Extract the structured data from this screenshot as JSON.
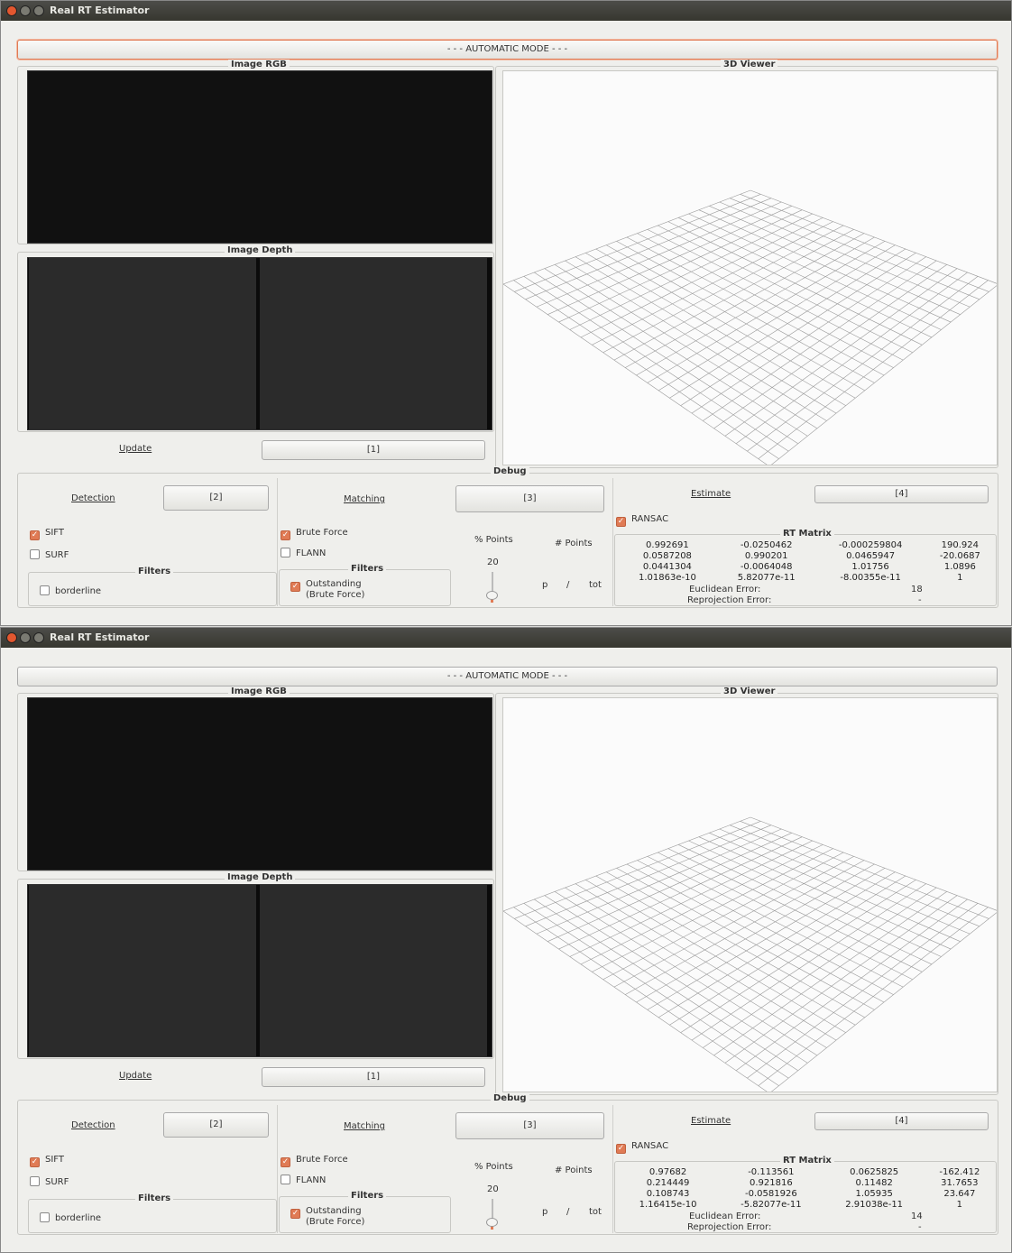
{
  "windows": [
    {
      "title": "Real RT Estimator",
      "mode_button": "- - - AUTOMATIC MODE - - -",
      "image_rgb_label": "Image RGB",
      "image_depth_label": "Image Depth",
      "viewer_label": "3D Viewer",
      "update_label": "Update",
      "btn1": "[1]",
      "debug_label": "Debug",
      "detection": {
        "label": "Detection",
        "btn": "[2]",
        "sift": "SIFT",
        "surf": "SURF",
        "filters_label": "Filters",
        "borderline": "borderline",
        "sift_checked": true,
        "surf_checked": false,
        "borderline_checked": false
      },
      "matching": {
        "label": "Matching",
        "btn": "[3]",
        "brute_force": "Brute Force",
        "flann": "FLANN",
        "filters_label": "Filters",
        "outstanding_line1": "Outstanding",
        "outstanding_line2": "(Brute Force)",
        "brute_checked": true,
        "flann_checked": false,
        "outstanding_checked": true,
        "pct_points_label": "% Points",
        "pct_points_value": "20",
        "num_points_label": "# Points",
        "p_label": "p",
        "slash": "/",
        "tot_label": "tot"
      },
      "estimate": {
        "label": "Estimate",
        "btn": "[4]",
        "ransac": "RANSAC",
        "ransac_checked": true,
        "rt_matrix_label": "RT Matrix",
        "matrix": [
          [
            "0.992691",
            "-0.0250462",
            "-0.000259804",
            "190.924"
          ],
          [
            "0.0587208",
            "0.990201",
            "0.0465947",
            "-20.0687"
          ],
          [
            "0.0441304",
            "-0.0064048",
            "1.01756",
            "1.0896"
          ],
          [
            "1.01863e-10",
            "5.82077e-11",
            "-8.00355e-11",
            "1"
          ]
        ],
        "euclidean_label": "Euclidean Error:",
        "euclidean_value": "18",
        "reprojection_label": "Reprojection Error:",
        "reprojection_value": "-"
      }
    },
    {
      "title": "Real RT Estimator",
      "mode_button": "- - - AUTOMATIC MODE - - -",
      "image_rgb_label": "Image RGB",
      "image_depth_label": "Image Depth",
      "viewer_label": "3D Viewer",
      "update_label": "Update",
      "btn1": "[1]",
      "debug_label": "Debug",
      "detection": {
        "label": "Detection",
        "btn": "[2]",
        "sift": "SIFT",
        "surf": "SURF",
        "filters_label": "Filters",
        "borderline": "borderline",
        "sift_checked": true,
        "surf_checked": false,
        "borderline_checked": false
      },
      "matching": {
        "label": "Matching",
        "btn": "[3]",
        "brute_force": "Brute Force",
        "flann": "FLANN",
        "filters_label": "Filters",
        "outstanding_line1": "Outstanding",
        "outstanding_line2": "(Brute Force)",
        "brute_checked": true,
        "flann_checked": false,
        "outstanding_checked": true,
        "pct_points_label": "% Points",
        "pct_points_value": "20",
        "num_points_label": "# Points",
        "p_label": "p",
        "slash": "/",
        "tot_label": "tot"
      },
      "estimate": {
        "label": "Estimate",
        "btn": "[4]",
        "ransac": "RANSAC",
        "ransac_checked": true,
        "rt_matrix_label": "RT Matrix",
        "matrix": [
          [
            "0.97682",
            "-0.113561",
            "0.0625825",
            "-162.412"
          ],
          [
            "0.214449",
            "0.921816",
            "0.11482",
            "31.7653"
          ],
          [
            "0.108743",
            "-0.0581926",
            "1.05935",
            "23.647"
          ],
          [
            "1.16415e-10",
            "-5.82077e-11",
            "2.91038e-11",
            "1"
          ]
        ],
        "euclidean_label": "Euclidean Error:",
        "euclidean_value": "14",
        "reprojection_label": "Reprojection Error:",
        "reprojection_value": "-"
      }
    }
  ],
  "colors": {
    "accent": "#e07b55",
    "window_bg": "#efefec",
    "titlebar": "#3c3c36"
  }
}
